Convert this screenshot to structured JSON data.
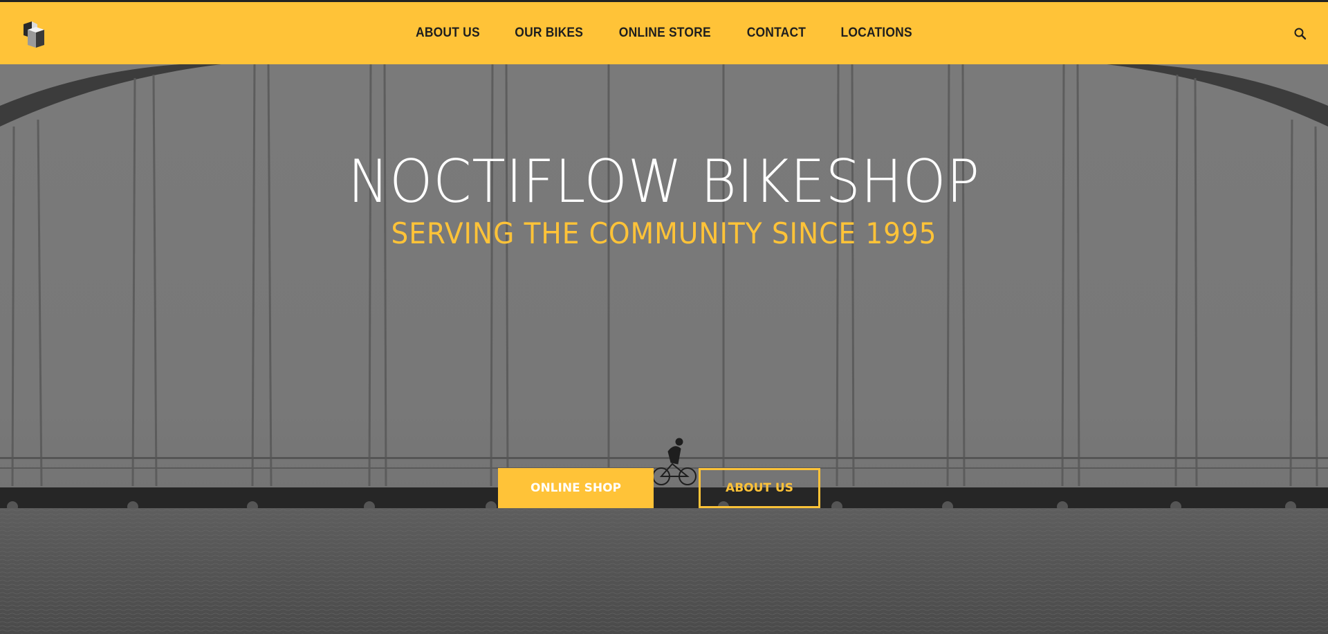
{
  "colors": {
    "accent": "#ffc338",
    "nav_text": "#1e1e1e",
    "hero_overlay": "#777777",
    "title_text": "#ffffff"
  },
  "header": {
    "logo_icon": "cube-logo-icon",
    "nav": [
      {
        "label": "ABOUT US"
      },
      {
        "label": "OUR BIKES"
      },
      {
        "label": "ONLINE STORE"
      },
      {
        "label": "CONTACT"
      },
      {
        "label": "LOCATIONS"
      }
    ],
    "search_icon": "search-icon"
  },
  "hero": {
    "title": "NOCTIFLOW BIKESHOP",
    "subtitle": "SERVING THE COMMUNITY SINCE 1995",
    "primary_button": "ONLINE SHOP",
    "secondary_button": "ABOUT US"
  }
}
